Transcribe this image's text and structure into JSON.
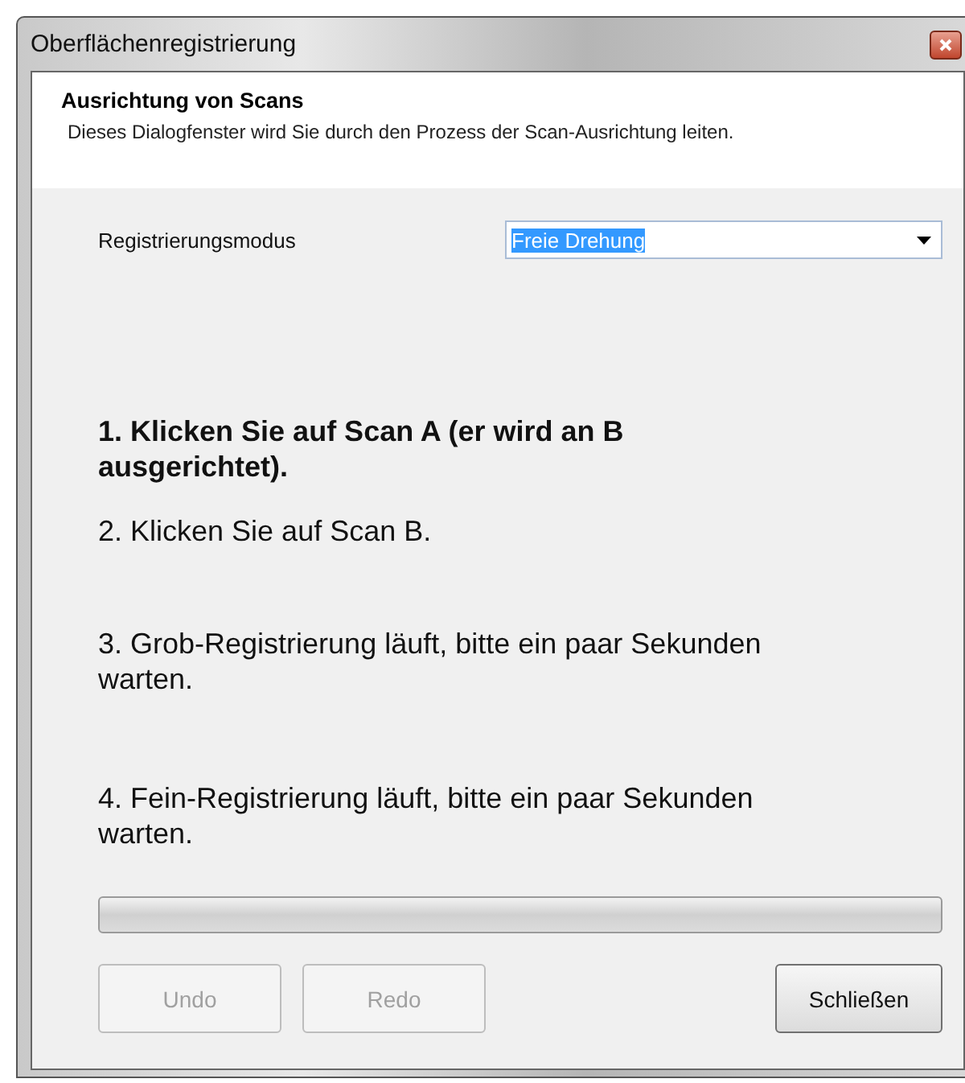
{
  "window": {
    "title": "Oberflächenregistrierung"
  },
  "header": {
    "title": "Ausrichtung von Scans",
    "description": "Dieses Dialogfenster wird Sie durch den Prozess der Scan-Ausrichtung leiten."
  },
  "mode": {
    "label": "Registrierungsmodus",
    "value": "Freie Drehung"
  },
  "steps": [
    {
      "text": "1. Klicken Sie auf Scan A (er wird an B ausgerichtet).",
      "active": true
    },
    {
      "text": "2. Klicken Sie auf Scan B.",
      "active": false
    },
    {
      "text": "3. Grob-Registrierung läuft, bitte ein paar Sekunden warten.",
      "active": false
    },
    {
      "text": "4. Fein-Registrierung läuft, bitte ein paar Sekunden warten.",
      "active": false
    }
  ],
  "progress": {
    "level": 0
  },
  "buttons": [
    {
      "label": "Undo",
      "disabled": true
    },
    {
      "label": "Redo",
      "disabled": true
    },
    {
      "label": "Schließen",
      "disabled": false
    }
  ]
}
